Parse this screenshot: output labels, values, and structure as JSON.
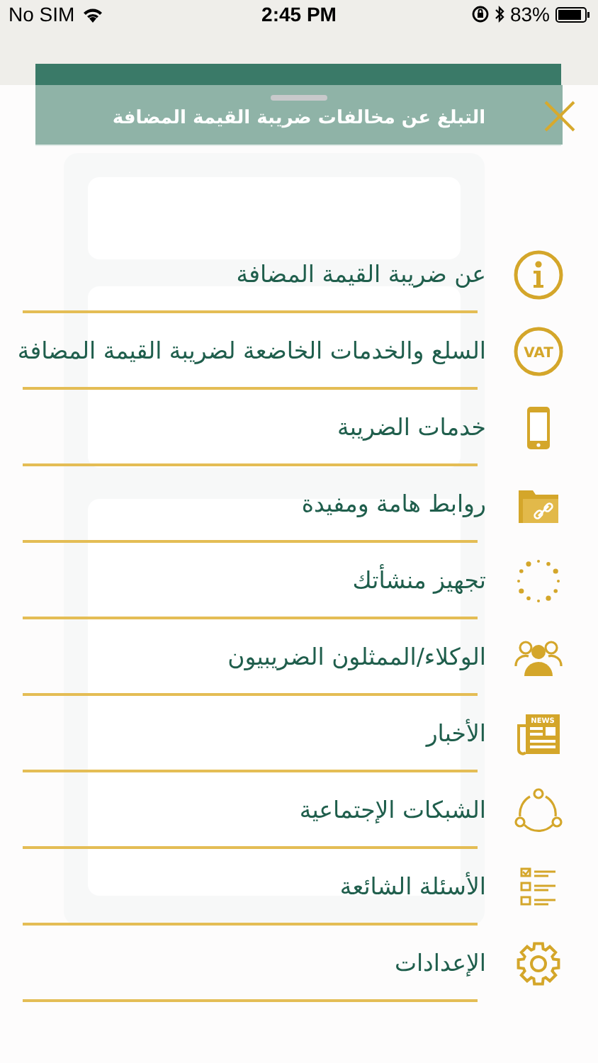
{
  "status_bar": {
    "carrier": "No SIM",
    "time": "2:45 PM",
    "battery": "83%"
  },
  "background_page": {
    "title": "التبلغ عن مخالفات ضريبة القيمة المضافة"
  },
  "menu": {
    "items": [
      {
        "label": "عن ضريبة القيمة المضافة",
        "kind": "info"
      },
      {
        "label": "السلع والخدمات الخاضعة لضريبة القيمة المضافة",
        "kind": "vat",
        "icon_text": "VAT"
      },
      {
        "label": "خدمات الضريبة",
        "kind": "phone"
      },
      {
        "label": "روابط هامة ومفيدة",
        "kind": "folder"
      },
      {
        "label": "تجهيز  منشأتك",
        "kind": "dots"
      },
      {
        "label": "الوكلاء/الممثلون الضريبيون",
        "kind": "people"
      },
      {
        "label": "الأخبار",
        "kind": "news",
        "icon_text": "NEWS"
      },
      {
        "label": "الشبكات الإجتماعية",
        "kind": "share"
      },
      {
        "label": "الأسئلة الشائعة",
        "kind": "checklist"
      },
      {
        "label": "الإعدادات",
        "kind": "gear"
      }
    ]
  }
}
